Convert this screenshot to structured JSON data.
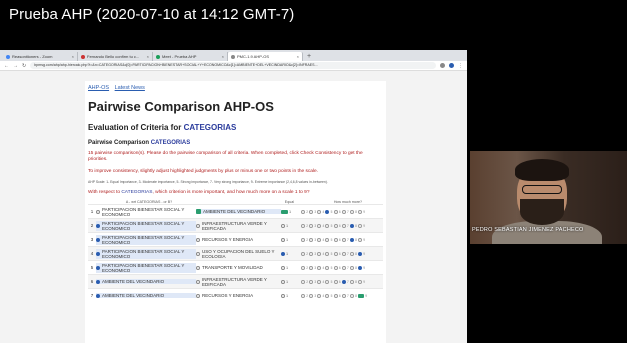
{
  "video": {
    "title": "Prueba AHP (2020-07-10 at 14:12 GMT-7)"
  },
  "browser": {
    "tabs": [
      {
        "label": "Reasonitioners - Zoom"
      },
      {
        "label": "Fernando Bello confirm tu c..."
      },
      {
        "label": "Meet - Prueba AHP"
      },
      {
        "label": "PMC-1.9 AHP-OS"
      }
    ],
    "new_tab": "+",
    "url": "bpmsg.com/ahp/ahp-hiercalc.php?t=&n=CATEGORIAS&c[0]=PARTICIPACION+BIENESTAR+SOCIAL+Y+ECONOMICO&c[1]=AMBIENTE+DEL+VECINDARIO&c[2]=INFRAES..."
  },
  "page": {
    "links": [
      "AHP-OS",
      "Latest News"
    ],
    "title": "Pairwise Comparison AHP-OS",
    "subtitle_prefix": "Evaluation of Criteria for",
    "subtitle_crit": "CATEGORIAS",
    "section_prefix": "Pairwise Comparison",
    "section_crit": "CATEGORIAS",
    "intro": "15 pairwise comparison(s). Please do the pairwise comparison of all criteria. When completed, click Check Consistency to get the priorities.",
    "intro2": "To improve consistency, slightly adjust highlighted judgments by plus or minus one or two points in the scale.",
    "scale_note": "AHP Scale: 1- Equal Importance, 3- Moderate importance, 5- Strong importance, 7- Very strong importance, 9- Extreme importance (2,4,6,8 values in-between).",
    "question_prefix": "With respect to",
    "question_crit": "CATEGORIAS",
    "question_suffix": ", which criterion is more important, and how much more on a scale 1 to 9?",
    "col_ab": "A - wrt CATEGORIAS - or B?",
    "col_equal": "Equal",
    "col_how": "How much more?"
  },
  "rows": [
    {
      "num": "1",
      "a": "PARTICIPACION BIENESTAR SOCIAL Y ECONOMICO",
      "b": "AMBIENTE DEL VECINDARIO",
      "a_sel": false,
      "b_sel": true,
      "eq": "1"
    },
    {
      "num": "2",
      "a": "PARTICIPACION BIENESTAR SOCIAL Y ECONOMICO",
      "b": "INFRAESTRUCTURA VERDE Y EDIFICADA",
      "a_sel": true,
      "b_sel": false,
      "eq": "1"
    },
    {
      "num": "3",
      "a": "PARTICIPACION BIENESTAR SOCIAL Y ECONOMICO",
      "b": "RECURSOS Y ENERGIA",
      "a_sel": true,
      "b_sel": false,
      "eq": "1"
    },
    {
      "num": "4",
      "a": "PARTICIPACION BIENESTAR SOCIAL Y ECONOMICO",
      "b": "USO Y OCUPACION DEL SUELO Y ECOLOGIA",
      "a_sel": true,
      "b_sel": false,
      "eq": "1"
    },
    {
      "num": "5",
      "a": "PARTICIPACION BIENESTAR SOCIAL Y ECONOMICO",
      "b": "TRANSPORTE Y MOVILIDAD",
      "a_sel": true,
      "b_sel": false,
      "eq": "1"
    },
    {
      "num": "6",
      "a": "AMBIENTE DEL VECINDARIO",
      "b": "INFRAESTRUCTURA VERDE Y EDIFICADA",
      "a_sel": true,
      "b_sel": false,
      "eq": "1"
    },
    {
      "num": "7",
      "a": "AMBIENTE DEL VECINDARIO",
      "b": "RECURSOS Y ENERGIA",
      "a_sel": true,
      "b_sel": false,
      "eq": "1"
    }
  ],
  "scale_numbers": [
    "2",
    "3",
    "4",
    "5",
    "6",
    "7",
    "8",
    "9"
  ],
  "webcam": {
    "name": "PEDRO SEBASTIAN JIMENEZ PACHECO"
  },
  "colors": {
    "accent": "#2a5db0",
    "criteria": "#2a3b9c",
    "instruction": "#b02020",
    "selected": "#2a9d6f"
  }
}
